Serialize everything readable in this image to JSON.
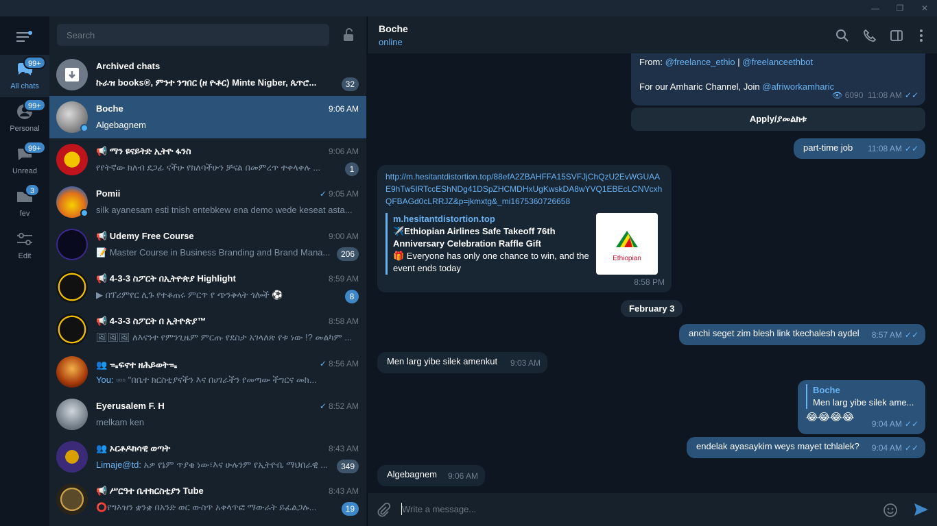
{
  "window": {
    "minimize": "—",
    "maximize": "❐",
    "close": "✕"
  },
  "search": {
    "placeholder": "Search"
  },
  "folders": [
    {
      "label": "All chats",
      "badge": "99+"
    },
    {
      "label": "Personal",
      "badge": "99+"
    },
    {
      "label": "Unread",
      "badge": "99+"
    },
    {
      "label": "fev",
      "badge": "3"
    },
    {
      "label": "Edit",
      "badge": ""
    }
  ],
  "chats": [
    {
      "name": "Archived chats",
      "time": "",
      "preview": "ኩራዝ books®, ምንተ ንግበር (ዘ ዮቶር) Minte Nigber, ጴጥሮ...",
      "badge": "32"
    },
    {
      "name": "Boche",
      "time": "9:06 AM",
      "preview": "Algebagnem",
      "badge": ""
    },
    {
      "name": "📢 ማን ዩናይትድ ኢትዮ ፋንስ",
      "time": "9:06 AM",
      "preview": "የየትኛው ክለብ  ደጋፊ ናችሁ  የክለባችሁን ቻናል በመምረጥ ተቀላቀሉ ...",
      "badge": "1"
    },
    {
      "name": "Pomii",
      "time": "9:05 AM",
      "preview": "silk ayanesam esti tnish entebkew ena demo wede keseat asta...",
      "badge": ""
    },
    {
      "name": "📢 Udemy Free Course",
      "time": "9:00 AM",
      "preview": "📝 Master Course in Business Branding and Brand Mana...",
      "badge": "206"
    },
    {
      "name": "📢 4-3-3 ስፖርት በኢትዮጵያ Highlight",
      "time": "8:59 AM",
      "preview": "▶ በፕሪምየር ሊጉ የተቆጠሩ ምርጥ የ ጭንቅላት ጎሎች  ⚽",
      "badge": "8"
    },
    {
      "name": "📢 4-3-3 ስፖርት በ ኢትዮጵያ™",
      "time": "8:58 AM",
      "preview": "🖼🖼🖼 ለእናንተ የምንጊዜም ምርጡ የደስታ አገላለጽ የቱ ነው !?  መልካም ...",
      "badge": ""
    },
    {
      "name": "👥 ᯓፍኖተ ዘሕይወትᯓ",
      "time": "8:56 AM",
      "preview": "▫▫▫ \"በቤተ ክርስቲያናችን እና በሀገራችን የመጣው ችግርና መከ...",
      "who": "You:",
      "badge": ""
    },
    {
      "name": "Eyerusalem F. H",
      "time": "8:52 AM",
      "preview": "melkam ken",
      "badge": ""
    },
    {
      "name": "👥 ኦርቶዶክሳዊ ወጣት",
      "time": "8:43 AM",
      "preview": "አዎ የኔም ጥያቄ ነው፣እና ሁሉንም የኢትዮቤ ማህበራዊ ...",
      "who": "Limaje@td:",
      "badge": "349"
    },
    {
      "name": "📢 ሥርዓተ ቤተክርስቲያን Tube",
      "time": "8:43 AM",
      "preview": "⭕የግእዝን ቋንቋ በአንድ ወር ውስጥ አቀላጥፎ ማውራት ይፈልጋሉ...",
      "badge": "19"
    }
  ],
  "header": {
    "title": "Boche",
    "status": "online"
  },
  "messages": {
    "fwd_from_label": "From: ",
    "fwd_h1": "@freelance_ethio",
    "fwd_sep": " | ",
    "fwd_h2": "@freelanceethbot",
    "fwd_line2": "For our Amharic Channel, Join ",
    "fwd_h3": "@afriworkamharic",
    "fwd_views": "6090",
    "fwd_time": "11:08 AM",
    "apply_button": "Apply/ያመልክቱ",
    "parttime_text": "part-time job",
    "parttime_time": "11:08 AM",
    "link_url": "http://m.hesitantdistortion.top/88efA2ZBAHFFA15SVFJjChQzU2EvWGUAAE9hTw5IRTccEShNDg41DSpZHCMDHxUgKwskDA8wYVQ1EBEcLCNVcxhQFBAGd0cLRRJZ&p=jkmxtg&_mi1675360726658",
    "link_site": "m.hesitantdistortion.top",
    "link_title": "✈️Ethiopian Airlines Safe Takeoff 76th Anniversary Celebration Raffle Gift",
    "link_desc": "🎁 Everyone has only one chance to win, and the event ends today",
    "link_img": "Ethiopian",
    "link_time": "8:58 PM",
    "date": "February 3",
    "m1_text": "anchi seget zim blesh link tkechalesh aydel",
    "m1_time": "8:57 AM",
    "m2_text": "Men larg yibe silek amenkut",
    "m2_time": "9:03 AM",
    "reply_name": "Boche",
    "reply_quote": "Men larg yibe silek ame...",
    "reply_text": "😂😂😂😂",
    "reply_time": "9:04 AM",
    "m3_text": "endelak ayasaykim weys mayet tchlalek?",
    "m3_time": "9:04 AM",
    "m4_text": "Algebagnem",
    "m4_time": "9:06 AM"
  },
  "composer": {
    "placeholder": "Write a message..."
  }
}
